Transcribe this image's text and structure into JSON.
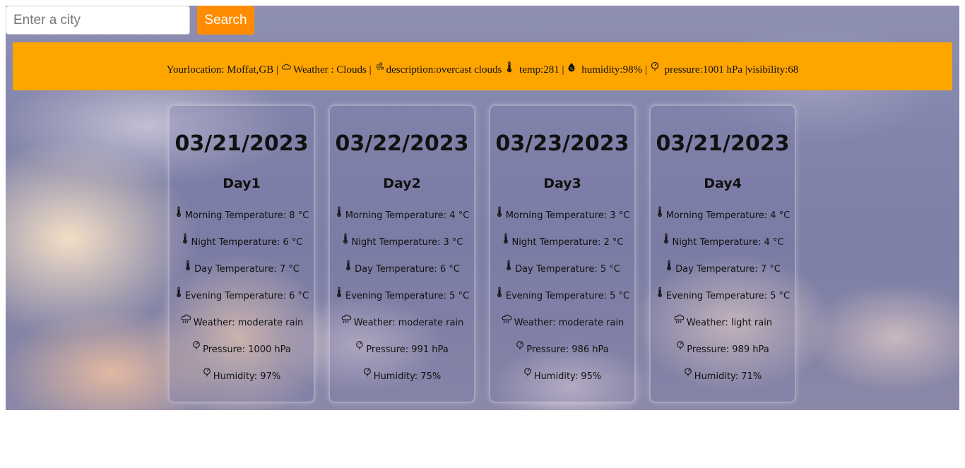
{
  "search": {
    "placeholder": "Enter a city",
    "value": "",
    "button_label": "Search"
  },
  "current": {
    "location_label": "Yourlocation:",
    "location": "Moffat,GB",
    "sep1": "|",
    "weather_label": "Weather :",
    "weather": "Clouds",
    "sep2": "|",
    "description_label": "description:",
    "description": "overcast clouds",
    "temp_label": "temp:",
    "temp": "281",
    "sep3": "|",
    "humidity_label": "humidity:",
    "humidity": "98%",
    "sep4": "|",
    "pressure_label": "pressure:",
    "pressure": "1001 hPa",
    "visibility_label": "|visibility:",
    "visibility": "68",
    "icons": [
      "cloud-icon",
      "wind-icon",
      "thermometer-icon",
      "humidity-icon",
      "pressure-icon"
    ]
  },
  "forecast": [
    {
      "date": "03/21/2023",
      "day": "Day1",
      "rows": [
        {
          "text": "Morning Temperature: 8 °C",
          "icon": "thermometer-icon"
        },
        {
          "text": "Night Temperature: 6 °C",
          "icon": "thermometer-icon"
        },
        {
          "text": "Day Temperature: 7 °C",
          "icon": "thermometer-icon"
        },
        {
          "text": "Evening Temperature: 6 °C",
          "icon": "thermometer-icon"
        },
        {
          "text": "Weather: moderate rain",
          "icon": "rain-cloud-icon"
        },
        {
          "text": "Pressure: 1000 hPa",
          "icon": "pressure-icon"
        },
        {
          "text": "Humidity: 97%",
          "icon": "pressure-icon"
        }
      ]
    },
    {
      "date": "03/22/2023",
      "day": "Day2",
      "rows": [
        {
          "text": "Morning Temperature: 4 °C",
          "icon": "thermometer-icon"
        },
        {
          "text": "Night Temperature: 3 °C",
          "icon": "thermometer-icon"
        },
        {
          "text": "Day Temperature: 6 °C",
          "icon": "thermometer-icon"
        },
        {
          "text": "Evening Temperature: 5 °C",
          "icon": "thermometer-icon"
        },
        {
          "text": "Weather: moderate rain",
          "icon": "rain-cloud-icon"
        },
        {
          "text": "Pressure: 991 hPa",
          "icon": "pressure-icon"
        },
        {
          "text": "Humidity: 75%",
          "icon": "pressure-icon"
        }
      ]
    },
    {
      "date": "03/23/2023",
      "day": "Day3",
      "rows": [
        {
          "text": "Morning Temperature: 3 °C",
          "icon": "thermometer-icon"
        },
        {
          "text": "Night Temperature: 2 °C",
          "icon": "thermometer-icon"
        },
        {
          "text": "Day Temperature: 5 °C",
          "icon": "thermometer-icon"
        },
        {
          "text": "Evening Temperature: 5 °C",
          "icon": "thermometer-icon"
        },
        {
          "text": "Weather: moderate rain",
          "icon": "rain-cloud-icon"
        },
        {
          "text": "Pressure: 986 hPa",
          "icon": "pressure-icon"
        },
        {
          "text": "Humidity: 95%",
          "icon": "pressure-icon"
        }
      ]
    },
    {
      "date": "03/21/2023",
      "day": "Day4",
      "rows": [
        {
          "text": "Morning Temperature: 4 °C",
          "icon": "thermometer-icon"
        },
        {
          "text": "Night Temperature: 4 °C",
          "icon": "thermometer-icon"
        },
        {
          "text": "Day Temperature: 7 °C",
          "icon": "thermometer-icon"
        },
        {
          "text": "Evening Temperature: 5 °C",
          "icon": "thermometer-icon"
        },
        {
          "text": "Weather: light rain",
          "icon": "rain-cloud-icon"
        },
        {
          "text": "Pressure: 989 hPa",
          "icon": "pressure-icon"
        },
        {
          "text": "Humidity: 71%",
          "icon": "pressure-icon"
        }
      ]
    }
  ],
  "colors": {
    "accent": "#ffa500",
    "button": "#ff8c00"
  }
}
